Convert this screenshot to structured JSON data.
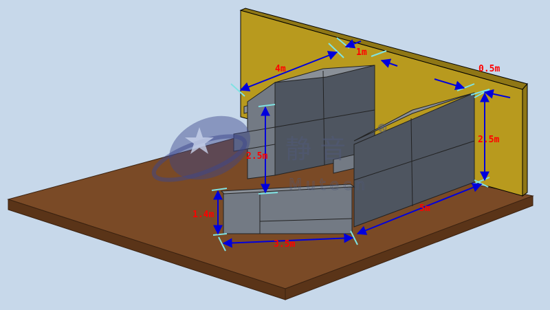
{
  "colors": {
    "background": "#c7d8ea",
    "floor_top": "#7a4a26",
    "floor_side": "#5a3418",
    "wall_front": "#b89a1e",
    "wall_edge": "#8f7716",
    "block_front": "#4e5560",
    "block_top": "#8a9098",
    "block_side": "#737a84",
    "dimension_line": "#0000dd",
    "dimension_text": "#ff0000",
    "extension_line": "#7fe3e3"
  },
  "dimensions": {
    "d_4m": "4m",
    "d_1m": "1m",
    "d_0_5m": "0.5m",
    "d_2_5m_right": "2.5m",
    "d_2_5m_left": "2.5m",
    "d_1_4m": "1.4m",
    "d_3_5m": "3.5m",
    "d_5m": "5m"
  },
  "watermark": {
    "chinese": "静 音",
    "english": "Mutecn",
    "registered": "®"
  }
}
